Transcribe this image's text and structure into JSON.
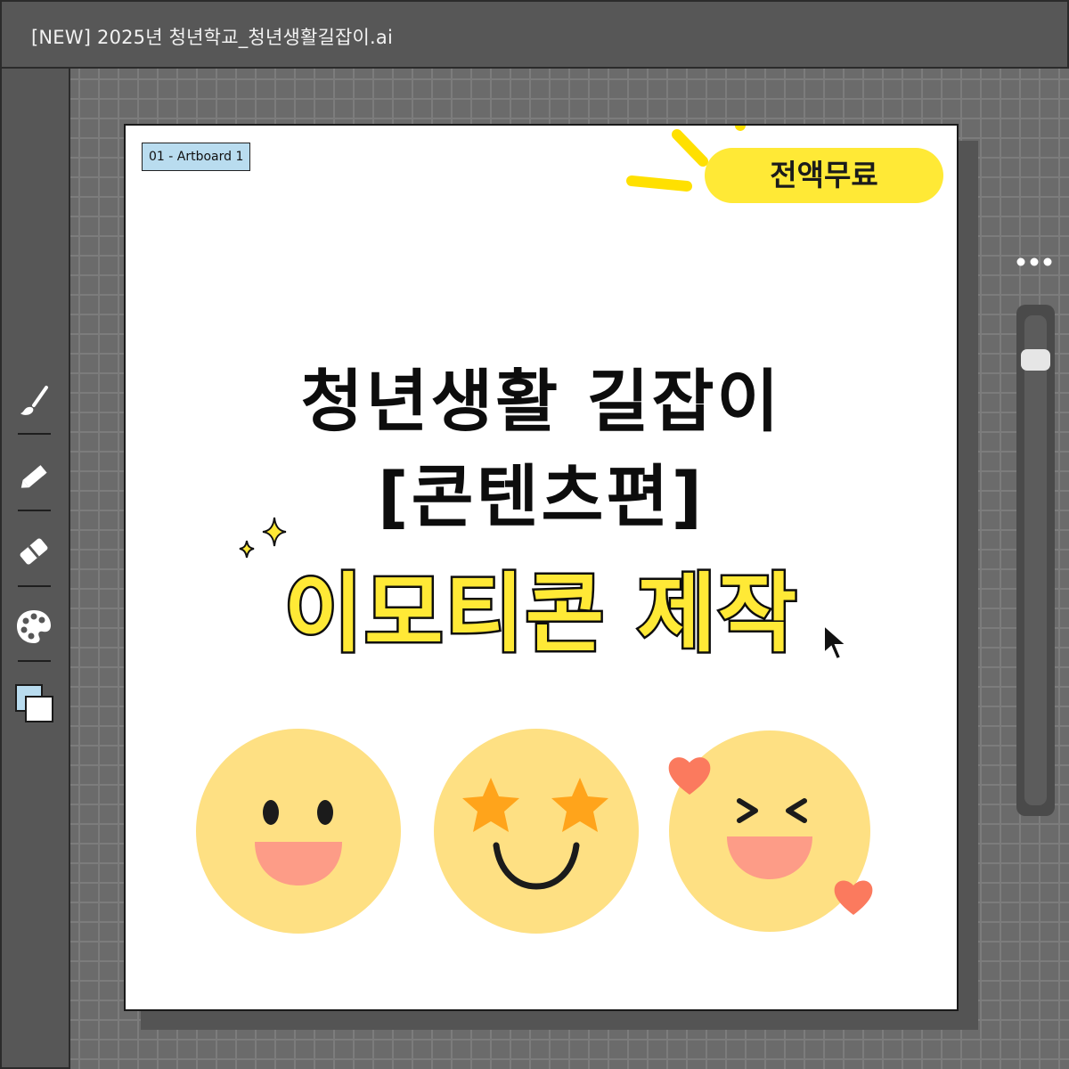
{
  "window": {
    "title": "[NEW] 2025년 청년학교_청년생활길잡이.ai"
  },
  "toolbar": {
    "tools": [
      {
        "name": "brush-tool",
        "icon": "paintbrush-icon"
      },
      {
        "name": "pencil-tool",
        "icon": "pencil-icon"
      },
      {
        "name": "eraser-tool",
        "icon": "eraser-icon"
      },
      {
        "name": "color-palette-tool",
        "icon": "palette-icon"
      },
      {
        "name": "fill-stroke-swatch",
        "icon": "fill-stroke-icon"
      }
    ]
  },
  "artboard": {
    "label": "01 - Artboard 1",
    "badge": "전액무료",
    "title_line1": "청년생활 길잡이",
    "title_line2": "[콘텐츠편]",
    "subtitle": "이모티콘 제작"
  },
  "colors": {
    "canvas_bg": "#6b6b6b",
    "chrome_bg": "#575757",
    "accent_yellow": "#ffe936",
    "emoji_face": "#fee083",
    "emoji_mouth": "#fd9c87",
    "star": "#ffa41b",
    "heart": "#fb7a5e",
    "artboard_label_bg": "#b9dcef"
  },
  "emojis": [
    "smiling-face-icon",
    "star-eyes-face-icon",
    "laughing-face-with-hearts-icon"
  ]
}
